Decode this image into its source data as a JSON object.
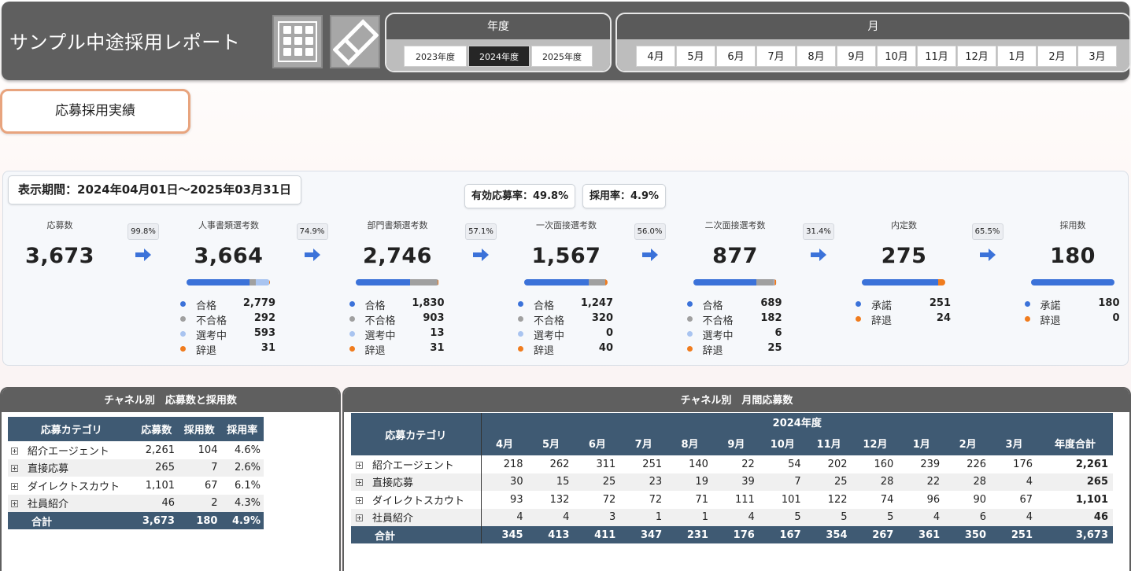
{
  "header": {
    "title": "サンプル中途採用レポート",
    "year_filter": {
      "label": "年度",
      "options": [
        "2023年度",
        "2024年度",
        "2025年度"
      ],
      "selected": "2024年度"
    },
    "month_filter": {
      "label": "月",
      "options": [
        "4月",
        "5月",
        "6月",
        "7月",
        "8月",
        "9月",
        "10月",
        "11月",
        "12月",
        "1月",
        "2月",
        "3月"
      ]
    },
    "icons": [
      "grid-icon",
      "eraser-icon"
    ]
  },
  "section_button": {
    "label": "応募採用実績"
  },
  "funnel": {
    "period": "表示期間：2024年04月01日～2025年03月31日",
    "effective_rate": "有効応募率：49.8%",
    "hire_rate": "採用率：4.9%",
    "conversions": [
      "99.8%",
      "74.9%",
      "57.1%",
      "56.0%",
      "31.4%",
      "65.5%"
    ],
    "colors": {
      "pass": "#3b72d9",
      "fail": "#a0a0a0",
      "in_progress": "#a9c4f0",
      "decline": "#f07c1e"
    },
    "stages": [
      {
        "label": "応募数",
        "value": "3,673",
        "breakdown": []
      },
      {
        "label": "人事書類選考数",
        "value": "3,664",
        "bar": [
          2779,
          292,
          593,
          31
        ],
        "breakdown": [
          {
            "label": "合格",
            "value": "2,779",
            "kind": "pass"
          },
          {
            "label": "不合格",
            "value": "292",
            "kind": "fail"
          },
          {
            "label": "選考中",
            "value": "593",
            "kind": "in_progress"
          },
          {
            "label": "辞退",
            "value": "31",
            "kind": "decline"
          }
        ]
      },
      {
        "label": "部門書類選考数",
        "value": "2,746",
        "bar": [
          1830,
          903,
          13,
          31
        ],
        "breakdown": [
          {
            "label": "合格",
            "value": "1,830",
            "kind": "pass"
          },
          {
            "label": "不合格",
            "value": "903",
            "kind": "fail"
          },
          {
            "label": "選考中",
            "value": "13",
            "kind": "in_progress"
          },
          {
            "label": "辞退",
            "value": "31",
            "kind": "decline"
          }
        ]
      },
      {
        "label": "一次面接選考数",
        "value": "1,567",
        "bar": [
          1247,
          320,
          0,
          40
        ],
        "breakdown": [
          {
            "label": "合格",
            "value": "1,247",
            "kind": "pass"
          },
          {
            "label": "不合格",
            "value": "320",
            "kind": "fail"
          },
          {
            "label": "選考中",
            "value": "0",
            "kind": "in_progress"
          },
          {
            "label": "辞退",
            "value": "40",
            "kind": "decline"
          }
        ]
      },
      {
        "label": "二次面接選考数",
        "value": "877",
        "bar": [
          689,
          182,
          6,
          25
        ],
        "breakdown": [
          {
            "label": "合格",
            "value": "689",
            "kind": "pass"
          },
          {
            "label": "不合格",
            "value": "182",
            "kind": "fail"
          },
          {
            "label": "選考中",
            "value": "6",
            "kind": "in_progress"
          },
          {
            "label": "辞退",
            "value": "25",
            "kind": "decline"
          }
        ]
      },
      {
        "label": "内定数",
        "value": "275",
        "bar": [
          251,
          0,
          0,
          24
        ],
        "breakdown": [
          {
            "label": "承諾",
            "value": "251",
            "kind": "pass"
          },
          {
            "label": "辞退",
            "value": "24",
            "kind": "decline"
          }
        ]
      },
      {
        "label": "採用数",
        "value": "180",
        "bar": [
          180,
          0,
          0,
          0
        ],
        "breakdown": [
          {
            "label": "承諾",
            "value": "180",
            "kind": "pass"
          },
          {
            "label": "辞退",
            "value": "0",
            "kind": "decline"
          }
        ]
      }
    ]
  },
  "channel_summary": {
    "title": "チャネル別　応募数と採用数",
    "columns": [
      "応募カテゴリ",
      "応募数",
      "採用数",
      "採用率"
    ],
    "rows": [
      [
        "紹介エージェント",
        "2,261",
        "104",
        "4.6%"
      ],
      [
        "直接応募",
        "265",
        "7",
        "2.6%"
      ],
      [
        "ダイレクトスカウト",
        "1,101",
        "67",
        "6.1%"
      ],
      [
        "社員紹介",
        "46",
        "2",
        "4.3%"
      ]
    ],
    "total": [
      "合計",
      "3,673",
      "180",
      "4.9%"
    ]
  },
  "channel_monthly": {
    "title": "チャネル別　月間応募数",
    "year_header": "2024年度",
    "category_header": "応募カテゴリ",
    "months": [
      "4月",
      "5月",
      "6月",
      "7月",
      "8月",
      "9月",
      "10月",
      "11月",
      "12月",
      "1月",
      "2月",
      "3月"
    ],
    "total_header": "年度合計",
    "rows": [
      {
        "name": "紹介エージェント",
        "values": [
          "218",
          "262",
          "311",
          "251",
          "140",
          "22",
          "54",
          "202",
          "160",
          "239",
          "226",
          "176"
        ],
        "total": "2,261"
      },
      {
        "name": "直接応募",
        "values": [
          "30",
          "15",
          "25",
          "23",
          "19",
          "39",
          "7",
          "25",
          "28",
          "22",
          "28",
          "4"
        ],
        "total": "265"
      },
      {
        "name": "ダイレクトスカウト",
        "values": [
          "93",
          "132",
          "72",
          "72",
          "71",
          "111",
          "101",
          "122",
          "74",
          "96",
          "90",
          "67"
        ],
        "total": "1,101"
      },
      {
        "name": "社員紹介",
        "values": [
          "4",
          "4",
          "3",
          "1",
          "1",
          "4",
          "5",
          "5",
          "5",
          "4",
          "6",
          "4"
        ],
        "total": "46"
      }
    ],
    "total_row": {
      "name": "合計",
      "values": [
        "345",
        "413",
        "411",
        "347",
        "231",
        "176",
        "167",
        "354",
        "267",
        "361",
        "350",
        "251"
      ],
      "total": "3,673"
    }
  }
}
